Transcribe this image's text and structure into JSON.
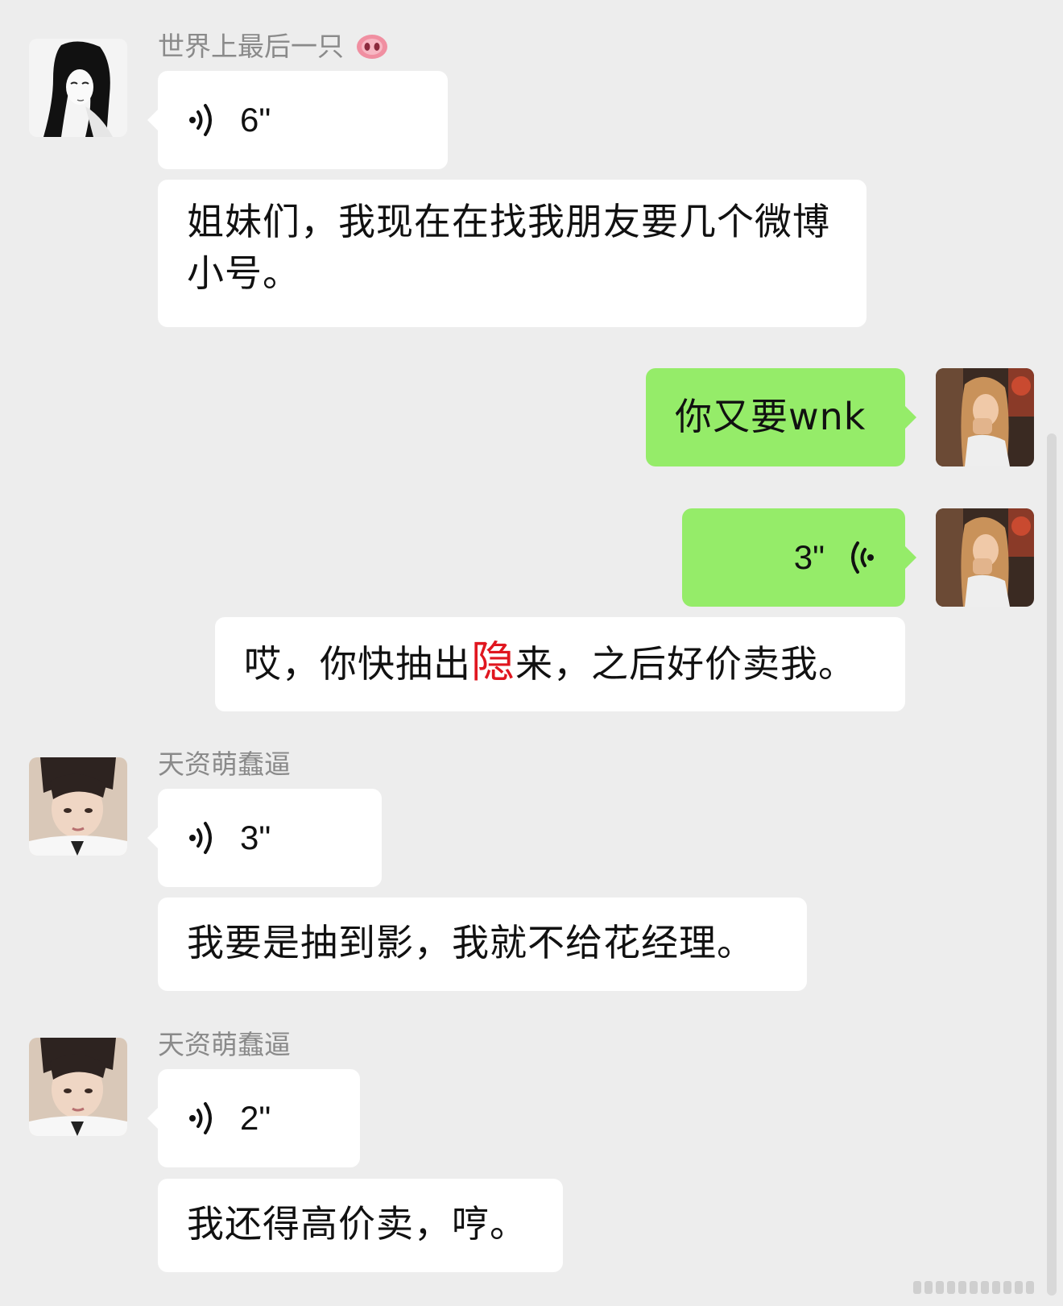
{
  "messages": {
    "m1": {
      "sender": "世界上最后一只",
      "sender_emoji": "🐽",
      "voice_duration": "6\""
    },
    "m2": {
      "text": "姐妹们，我现在在找我朋友要几个微博小号。"
    },
    "m3": {
      "text": "你又要wnk"
    },
    "m4": {
      "voice_duration": "3\""
    },
    "m5": {
      "text_before": "哎，你快抽出",
      "text_highlight": "隐",
      "text_after": "来，之后好价卖我。"
    },
    "m6": {
      "sender": "天资萌蠢逼",
      "voice_duration": "3\""
    },
    "m7": {
      "text": "我要是抽到影，我就不给花经理。"
    },
    "m8": {
      "sender": "天资萌蠢逼",
      "voice_duration": "2\""
    },
    "m9": {
      "text": "我还得高价卖，哼。"
    }
  },
  "colors": {
    "background": "#ededed",
    "incoming_bubble": "#ffffff",
    "outgoing_bubble": "#95ec69",
    "sender_name": "#8a8a8a",
    "highlight": "#e0161f"
  },
  "icons": {
    "voice_incoming": "voice-wave-icon",
    "voice_outgoing": "voice-wave-icon-mirrored",
    "sender_emoji": "pig-nose-icon"
  }
}
